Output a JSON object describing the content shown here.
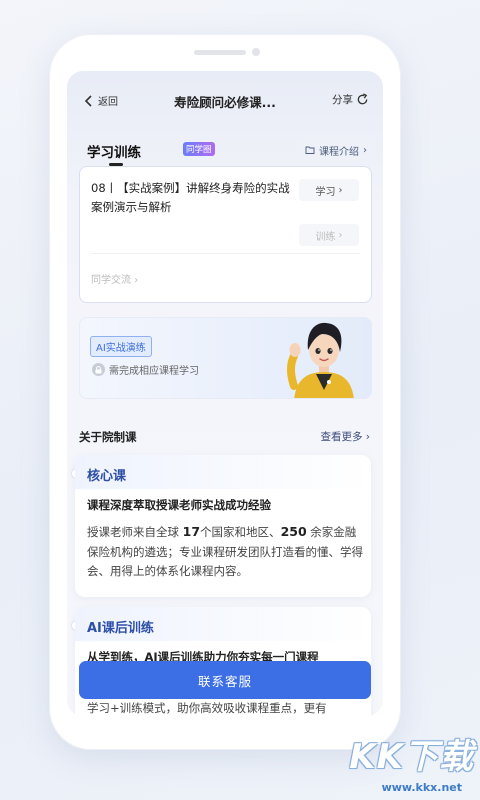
{
  "nav": {
    "back_label": "返回",
    "title": "寿险顾问必修课...",
    "share_label": "分享"
  },
  "tabs": {
    "main": "学习训练",
    "badge": "同学圈",
    "right": "课程介绍"
  },
  "lesson": {
    "title": "08丨【实战案例】讲解终身寿险的实战案例演示与解析",
    "study_btn": "学习",
    "train_btn": "训练",
    "discuss": "同学交流"
  },
  "ai": {
    "tag": "AI实战演练",
    "lock_text": "需完成相应课程学习"
  },
  "about": {
    "title": "关于院制课",
    "more": "查看更多"
  },
  "core": {
    "title": "核心课",
    "subtitle": "课程深度萃取授课老师实战成功经验",
    "text_a": "授课老师来自全球 ",
    "num_a": "17",
    "text_b": "个国家和地区、",
    "num_b": "250",
    "text_c": " 余家金融保险机构的遴选；专业课程研发团队打造看的懂、学得会、用得上的体系化课程内容。"
  },
  "after": {
    "title": "AI课后训练",
    "subtitle": "从学到练，AI课后训练助力你夯实每一门课程",
    "text": "学习+训练模式，助你高效吸收课程重点，更有"
  },
  "contact_btn": "联系客服",
  "watermark": {
    "brand": "KK下载",
    "url": "www.kkx.net"
  },
  "colors": {
    "accent": "#3c6ee6",
    "course_title": "#2d4fa8"
  }
}
